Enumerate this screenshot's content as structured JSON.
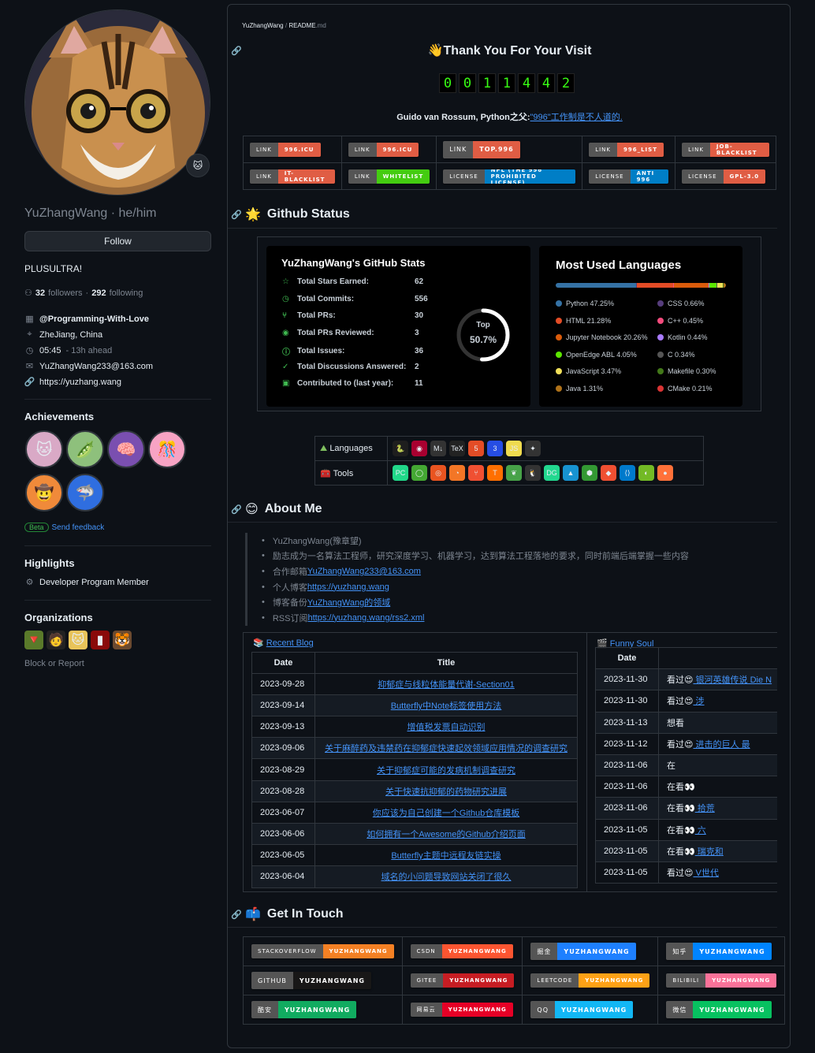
{
  "profile": {
    "username": "YuZhangWang",
    "pronouns": "he/him",
    "name_line": "YuZhangWang · he/him",
    "follow_label": "Follow",
    "bio": "PLUSULTRA!",
    "followers_count": "32",
    "followers_label": "followers",
    "following_count": "292",
    "following_label": "following",
    "dot": " · ",
    "org": "@Programming-With-Love",
    "location": "ZheJiang, China",
    "time": "05:45",
    "time_note": "- 13h ahead",
    "email": "YuZhangWang233@163.com",
    "website": "https://yuzhang.wang",
    "status_emoji": "🐱"
  },
  "achievements": {
    "title": "Achievements",
    "beta": "Beta",
    "feedback": "Send feedback"
  },
  "highlights": {
    "title": "Highlights",
    "item": "Developer Program Member"
  },
  "organizations": {
    "title": "Organizations",
    "block": "Block or Report"
  },
  "readme": {
    "crumb_user": "YuZhangWang",
    "crumb_sep": " / ",
    "crumb_file": "README",
    "crumb_ext": ".md",
    "title": "👋Thank You For Your Visit",
    "counter": [
      "0",
      "0",
      "1",
      "1",
      "4",
      "4",
      "2"
    ],
    "quote_prefix": "Guido van Rossum, Python之父:",
    "quote_link": "\"996\"工作制是不人道的."
  },
  "badges": [
    [
      {
        "l": "LINK",
        "r": "996.ICU",
        "c": "#e05d44"
      },
      {
        "l": "LINK",
        "r": "996.ICU",
        "c": "#e05d44"
      },
      {
        "l": "LINK",
        "r": "TOP.996",
        "c": "#e05d44",
        "big": true
      },
      {
        "l": "LINK",
        "r": "996_LIST",
        "c": "#e05d44"
      },
      {
        "l": "LINK",
        "r": "JOB-BLACKLIST",
        "c": "#e05d44"
      }
    ],
    [
      {
        "l": "LINK",
        "r": "IT-BLACKLIST",
        "c": "#e05d44"
      },
      {
        "l": "LINK",
        "r": "WHITELIST",
        "c": "#4c1"
      },
      {
        "l": "LICENSE",
        "r": "NPL (THE 996 PROHIBITED LICENSE)",
        "c": "#007ec6"
      },
      {
        "l": "LICENSE",
        "r": "ANTI 996",
        "c": "#007ec6"
      },
      {
        "l": "LICENSE",
        "r": "GPL-3.0",
        "c": "#e05d44"
      }
    ]
  ],
  "github_status": {
    "heading": "Github Status",
    "emoji": "🌟"
  },
  "stats": {
    "title": "YuZhangWang's GitHub Stats",
    "rows": [
      {
        "icon": "☆",
        "label": "Total Stars Earned:",
        "value": "62"
      },
      {
        "icon": "◷",
        "label": "Total Commits:",
        "value": "556"
      },
      {
        "icon": "⑂",
        "label": "Total PRs:",
        "value": "30"
      },
      {
        "icon": "◉",
        "label": "Total PRs Reviewed:",
        "value": "3"
      },
      {
        "icon": "ⓘ",
        "label": "Total Issues:",
        "value": "36"
      },
      {
        "icon": "✓",
        "label": "Total Discussions Answered:",
        "value": "2"
      },
      {
        "icon": "▣",
        "label": "Contributed to (last year):",
        "value": "11"
      }
    ],
    "rank_top": "Top",
    "rank_value": "50.7%",
    "rank_fraction": 0.507
  },
  "languages": {
    "title": "Most Used Languages",
    "items": [
      {
        "name": "Python 47.25%",
        "color": "#3572A5",
        "pct": 47.25
      },
      {
        "name": "CSS 0.66%",
        "color": "#563d7c",
        "pct": 0.66
      },
      {
        "name": "HTML 21.28%",
        "color": "#e34c26",
        "pct": 21.28
      },
      {
        "name": "C++ 0.45%",
        "color": "#f34b7d",
        "pct": 0.45
      },
      {
        "name": "Jupyter Notebook 20.26%",
        "color": "#DA5B0B",
        "pct": 20.26
      },
      {
        "name": "Kotlin 0.44%",
        "color": "#A97BFF",
        "pct": 0.44
      },
      {
        "name": "OpenEdge ABL 4.05%",
        "color": "#5ce600",
        "pct": 4.05
      },
      {
        "name": "C 0.34%",
        "color": "#555555",
        "pct": 0.34
      },
      {
        "name": "JavaScript 3.47%",
        "color": "#f1e05a",
        "pct": 3.47
      },
      {
        "name": "Makefile 0.30%",
        "color": "#427819",
        "pct": 0.3
      },
      {
        "name": "Java 1.31%",
        "color": "#b07219",
        "pct": 1.31
      },
      {
        "name": "CMake 0.21%",
        "color": "#DA3434",
        "pct": 0.21
      }
    ]
  },
  "skills": {
    "languages_label": "Languages",
    "tools_label": "Tools",
    "lang_icons": [
      {
        "n": "python-icon",
        "g": "🐍",
        "c": "#1e1e1e"
      },
      {
        "n": "debian-icon",
        "g": "◉",
        "c": "#a80030"
      },
      {
        "n": "markdown-icon",
        "g": "M↓",
        "c": "#333"
      },
      {
        "n": "latex-icon",
        "g": "TeX",
        "c": "#222"
      },
      {
        "n": "html5-icon",
        "g": "5",
        "c": "#e34c26"
      },
      {
        "n": "css3-icon",
        "g": "3",
        "c": "#264de4"
      },
      {
        "n": "javascript-icon",
        "g": "JS",
        "c": "#f0db4f"
      },
      {
        "n": "julia-icon",
        "g": "✦",
        "c": "#333"
      }
    ],
    "tool_icons": [
      {
        "n": "pycharm-icon",
        "g": "PC",
        "c": "#21d789"
      },
      {
        "n": "anaconda-icon",
        "g": "◯",
        "c": "#44a833"
      },
      {
        "n": "ubuntu-icon",
        "g": "◎",
        "c": "#e95420"
      },
      {
        "n": "jupyter-icon",
        "g": "◔",
        "c": "#f37626"
      },
      {
        "n": "git-icon",
        "g": "⑂",
        "c": "#f05032"
      },
      {
        "n": "tensorflow-icon",
        "g": "T",
        "c": "#ff6f00"
      },
      {
        "n": "mongodb-icon",
        "g": "❦",
        "c": "#47a248"
      },
      {
        "n": "linux-icon",
        "g": "🐧",
        "c": "#333"
      },
      {
        "n": "datagrip-icon",
        "g": "DG",
        "c": "#22d88f"
      },
      {
        "n": "arch-icon",
        "g": "▲",
        "c": "#1793d1"
      },
      {
        "n": "nodejs-icon",
        "g": "⬢",
        "c": "#339933"
      },
      {
        "n": "git-alt-icon",
        "g": "◆",
        "c": "#f05032"
      },
      {
        "n": "vscode-icon",
        "g": "⟨⟩",
        "c": "#007acc"
      },
      {
        "n": "opensuse-icon",
        "g": "◐",
        "c": "#73ba25"
      },
      {
        "n": "firefox-icon",
        "g": "●",
        "c": "#ff7139"
      }
    ]
  },
  "about": {
    "heading": "About Me",
    "emoji": "😊",
    "items": [
      {
        "text": "YuZhangWang(豫章望)",
        "link": ""
      },
      {
        "text": "励志成为一名算法工程师，研究深度学习、机器学习，达到算法工程落地的要求，同时前端后端掌握一些内容",
        "link": ""
      },
      {
        "text": "合作邮箱",
        "link": "YuZhangWang233@163.com"
      },
      {
        "text": "个人博客",
        "link": "https://yuzhang.wang"
      },
      {
        "text": "博客备份",
        "link": "YuZhangWang的领域"
      },
      {
        "text": "RSS订阅",
        "link": "https://yuzhang.wang/rss2.xml"
      }
    ]
  },
  "blog": {
    "title": "Recent Blog",
    "date_header": "Date",
    "title_header": "Title",
    "rows": [
      {
        "date": "2023-09-28",
        "title": "抑郁症与线粒体能量代谢-Section01"
      },
      {
        "date": "2023-09-14",
        "title": "Butterfly中Note标签使用方法"
      },
      {
        "date": "2023-09-13",
        "title": "增值税发票自动识别"
      },
      {
        "date": "2023-09-06",
        "title": "关于麻醉药及违禁药在抑郁症快速起效领域应用情况的调查研究"
      },
      {
        "date": "2023-08-29",
        "title": "关于抑郁症可能的发病机制调查研究"
      },
      {
        "date": "2023-08-28",
        "title": "关于快速抗抑郁的药物研究进展"
      },
      {
        "date": "2023-06-07",
        "title": "你应该为自己创建一个Github仓库模板"
      },
      {
        "date": "2023-06-06",
        "title": "如何拥有一个Awesome的Github介绍页面"
      },
      {
        "date": "2023-06-05",
        "title": "Butterfly主题中远程友链实操"
      },
      {
        "date": "2023-06-04",
        "title": "域名的小问题导致网站关闭了很久"
      }
    ]
  },
  "soul": {
    "title": "Funny Soul",
    "date_header": "Date",
    "rows": [
      {
        "date": "2023-11-30",
        "pre": "看过😍",
        "link": "银河英雄传说 Die N"
      },
      {
        "date": "2023-11-30",
        "pre": "看过😍",
        "link": "涉"
      },
      {
        "date": "2023-11-13",
        "pre": "想看",
        "link": ""
      },
      {
        "date": "2023-11-12",
        "pre": "看过😍",
        "link": "进击的巨人 最"
      },
      {
        "date": "2023-11-06",
        "pre": "在",
        "link": ""
      },
      {
        "date": "2023-11-06",
        "pre": "在看👀",
        "link": ""
      },
      {
        "date": "2023-11-06",
        "pre": "在看👀",
        "link": "拾荒"
      },
      {
        "date": "2023-11-05",
        "pre": "在看👀",
        "link": "六"
      },
      {
        "date": "2023-11-05",
        "pre": "在看👀",
        "link": "瑞克和"
      },
      {
        "date": "2023-11-05",
        "pre": "看过😍",
        "link": "V世代"
      }
    ]
  },
  "contact": {
    "heading": "Get In Touch",
    "emoji": "📫",
    "rows": [
      [
        {
          "l": "STACKOVERFLOW",
          "r": "YUZHANGWANG",
          "c": "#f48024"
        },
        {
          "l": "CSDN",
          "r": "YUZHANGWANG",
          "c": "#fc5531"
        },
        {
          "l": "掘金",
          "r": "YUZHANGWANG",
          "c": "#1e80ff",
          "big": true
        },
        {
          "l": "知乎",
          "r": "YUZHANGWANG",
          "c": "#0084ff",
          "big": true
        }
      ],
      [
        {
          "l": "GITHUB",
          "r": "YUZHANGWANG",
          "c": "#181717",
          "big": true
        },
        {
          "l": "GITEE",
          "r": "YUZHANGWANG",
          "c": "#c71d23"
        },
        {
          "l": "LEETCODE",
          "r": "YUZHANGWANG",
          "c": "#ffa116"
        },
        {
          "l": "BILIBILI",
          "r": "YUZHANGWANG",
          "c": "#fb7299"
        }
      ],
      [
        {
          "l": "酷安",
          "r": "YUZHANGWANG",
          "c": "#11ab60",
          "big": true
        },
        {
          "l": "网易云",
          "r": "YUZHANGWANG",
          "c": "#e60026"
        },
        {
          "l": "QQ",
          "r": "YUZHANGWANG",
          "c": "#12b7f5",
          "big": true
        },
        {
          "l": "微信",
          "r": "YUZHANGWANG",
          "c": "#07c160",
          "big": true
        }
      ]
    ]
  }
}
